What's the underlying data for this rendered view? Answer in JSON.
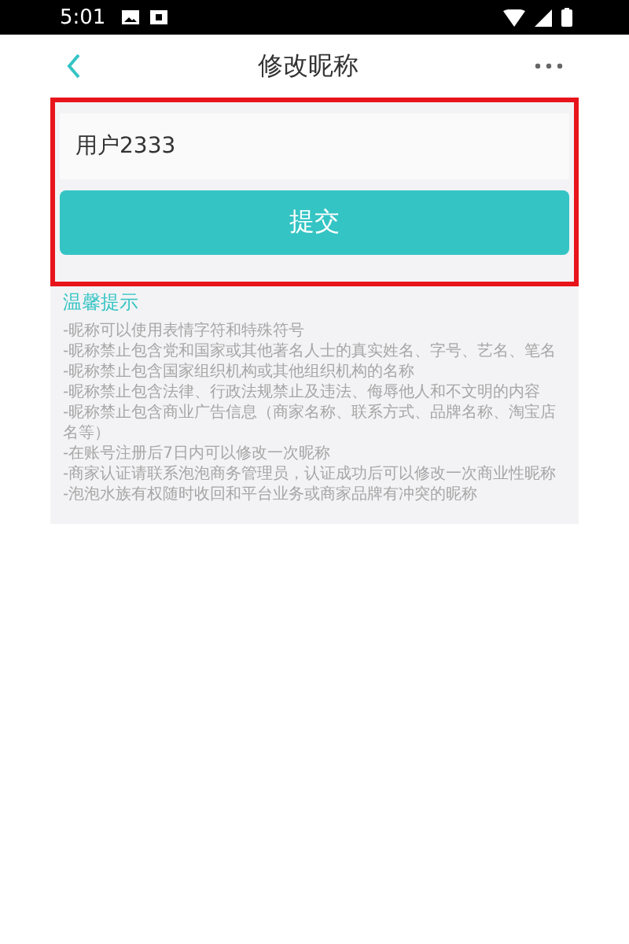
{
  "status_bar": {
    "time": "5:01"
  },
  "header": {
    "title": "修改昵称"
  },
  "nickname_field": {
    "value": "用户2333"
  },
  "submit_button": {
    "label": "提交"
  },
  "tips": {
    "title": "温馨提示",
    "items": [
      "-昵称可以使用表情字符和特殊符号",
      "-昵称禁止包含党和国家或其他著名人士的真实姓名、字号、艺名、笔名",
      "-昵称禁止包含国家组织机构或其他组织机构的名称",
      "-昵称禁止包含法律、行政法规禁止及违法、侮辱他人和不文明的内容",
      "-昵称禁止包含商业广告信息（商家名称、联系方式、品牌名称、淘宝店名等）",
      "-在账号注册后7日内可以修改一次昵称",
      "-商家认证请联系泡泡商务管理员，认证成功后可以修改一次商业性昵称",
      "-泡泡水族有权随时收回和平台业务或商家品牌有冲突的昵称"
    ]
  }
}
